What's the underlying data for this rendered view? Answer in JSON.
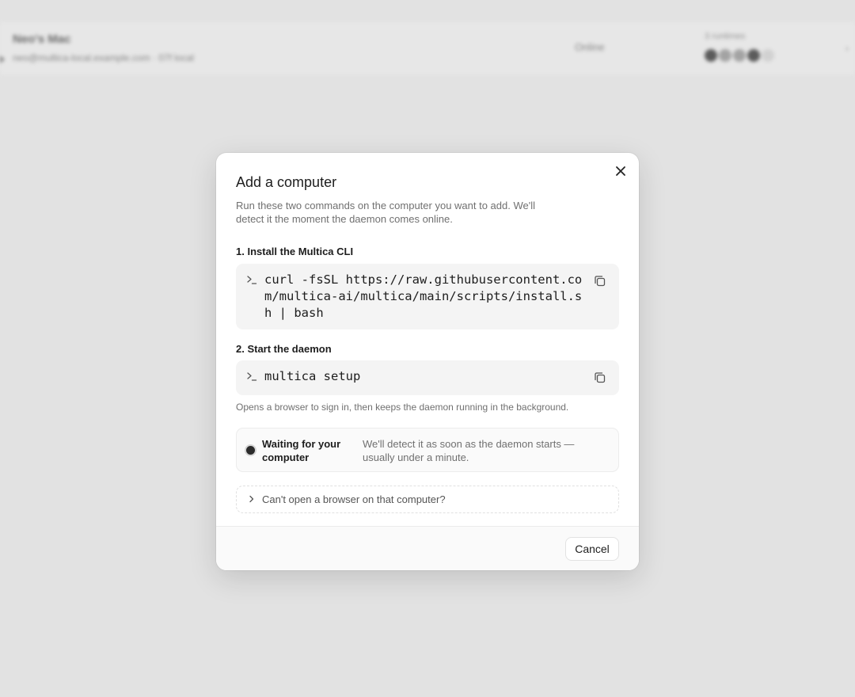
{
  "background": {
    "name": "Neo's Mac",
    "email": "neo@multica-local.example.com · 07f local",
    "status": "Online",
    "runtimes_label": "3 runtimes"
  },
  "modal": {
    "title": "Add a computer",
    "description": "Run these two commands on the computer you want to add. We'll detect it the moment the daemon comes online.",
    "close_icon": "close-icon",
    "steps": [
      {
        "title": "1. Install the Multica CLI",
        "command": "curl -fsSL https://raw.githubusercontent.com/multica-ai/multica/main/scripts/install.sh | bash",
        "prompt_icon": "terminal-prompt-icon",
        "copy_icon": "copy-icon"
      },
      {
        "title": "2. Start the daemon",
        "command": "multica setup",
        "prompt_icon": "terminal-prompt-icon",
        "copy_icon": "copy-icon"
      }
    ],
    "hint": "Opens a browser to sign in, then keeps the daemon running in the background.",
    "waiting": {
      "title": "Waiting for your computer",
      "description": "We'll detect it as soon as the daemon starts — usually under a minute."
    },
    "fallback": {
      "label": "Can't open a browser on that computer?",
      "icon": "chevron-right-icon"
    },
    "footer": {
      "cancel_label": "Cancel"
    }
  }
}
